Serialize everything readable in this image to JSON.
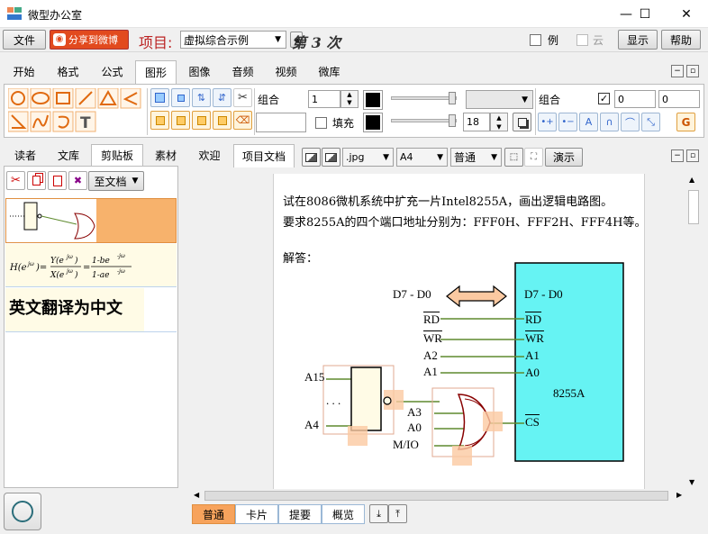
{
  "window": {
    "title": "微型办公室",
    "min": "—",
    "max": "☐",
    "close": "✕"
  },
  "menubar": {
    "file": "文件",
    "share": "分享到微博",
    "project_label": "项目:",
    "project_value": "虚拟综合示例",
    "episode": "第 3 次",
    "example": "例",
    "cloud": "云",
    "display": "显示",
    "help": "帮助"
  },
  "ribbon_tabs": [
    "开始",
    "格式",
    "公式",
    "图形",
    "图像",
    "音频",
    "视频",
    "微库"
  ],
  "ribbon_active": "图形",
  "ribbon": {
    "group_label": "组合",
    "size_value": "1",
    "fill_label": "填充",
    "font_size": "18",
    "group2_label": "组合",
    "field_a": "0",
    "field_b": "0"
  },
  "left_tabs": [
    "读者",
    "文库",
    "剪贴板",
    "素材"
  ],
  "left_active": "剪贴板",
  "left_toolbar": {
    "to_doc": "至文档"
  },
  "clip_items": {
    "formula": "H(e^jω)=Y(e^jω)/X(e^jω)=(1-be^-jω)/(1-ae^-jω)",
    "text": "英文翻译为中文"
  },
  "doc_tabs": [
    "欢迎",
    "项目文档"
  ],
  "doc_active": "项目文档",
  "doc_toolbar": {
    "format": ".jpg",
    "paper": "A4",
    "mode": "普通",
    "present": "演示"
  },
  "document": {
    "line1": "试在8086微机系统中扩充一片Intel8255A，画出逻辑电路图。",
    "line2": "要求8255A的四个端口地址分别为：FFF0H、FFF2H、FFF4H等。",
    "answer": "解答：",
    "chip": "8255A",
    "labels": {
      "d_left": "D7 - D0",
      "d_right": "D7 - D0",
      "rd": "RD",
      "wr": "WR",
      "a2": "A2",
      "a1": "A1",
      "a1r": "A1",
      "a0r": "A0",
      "cs": "CS",
      "a15": "A15",
      "dots": ". . .",
      "a4": "A4",
      "a3": "A3",
      "a0": "A0",
      "mio": "M/IO"
    }
  },
  "bottom_tabs": [
    "普通",
    "卡片",
    "提要",
    "概览"
  ],
  "bottom_active": "普通",
  "colors": {
    "accent_orange": "#f7a35c",
    "chip_fill": "#66f3f3",
    "arrow_fill": "#fbc9a1",
    "wire_green": "#5e8a2e",
    "share_red": "#e24a1e"
  }
}
